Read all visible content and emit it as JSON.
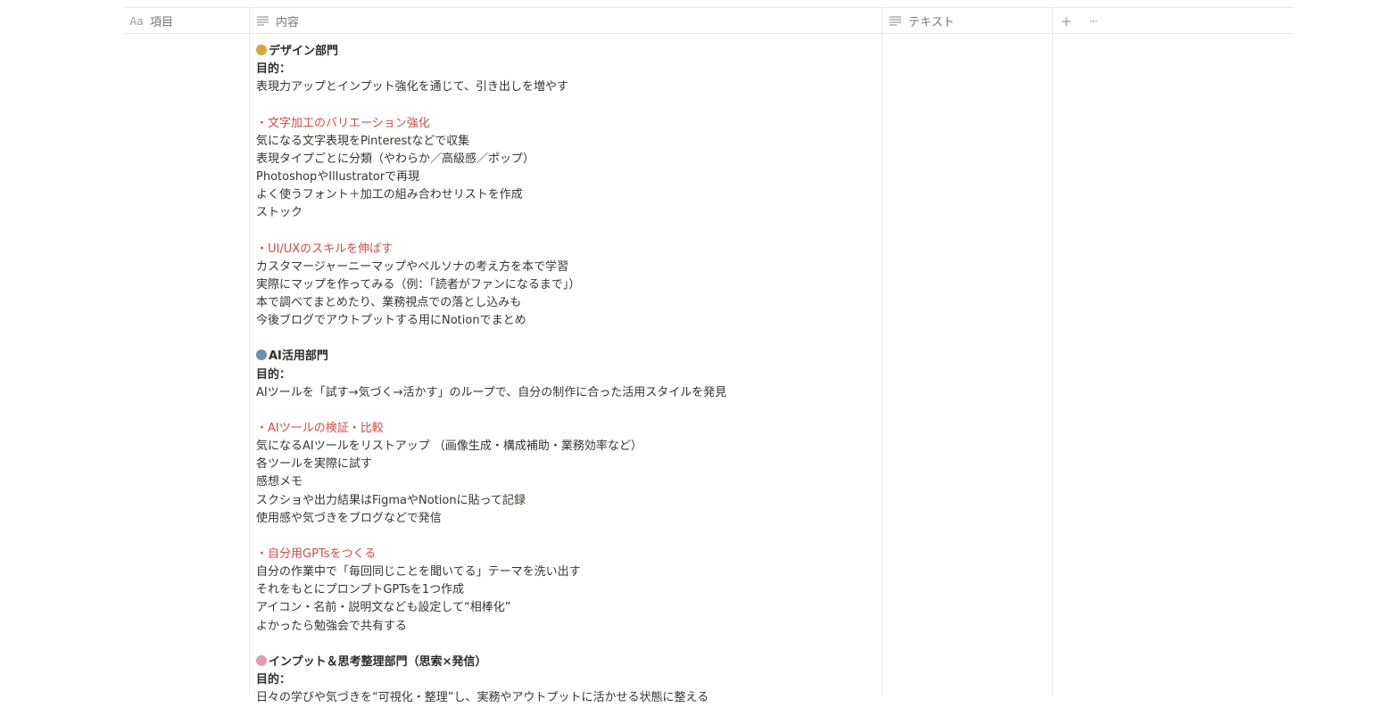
{
  "header": {
    "item": {
      "icon": "Aa",
      "label": "項目"
    },
    "content": {
      "icon": "text-lines-icon",
      "label": "内容"
    },
    "text": {
      "icon": "text-lines-icon",
      "label": "テキスト"
    },
    "add_icon": "+",
    "more_icon": "···"
  },
  "content_lines": [
    {
      "text": "デザイン部門",
      "style": "bold",
      "emoji": "palette-icon",
      "emoji_color": "#d9a441"
    },
    {
      "text": "目的：",
      "style": "bold"
    },
    {
      "text": "表現力アップとインプット強化を通じて、引き出しを増やす",
      "style": "normal"
    },
    {
      "text": "",
      "style": "blank"
    },
    {
      "text": "・文字加工のバリエーション強化",
      "style": "red"
    },
    {
      "text": "気になる文字表現をPinterestなどで収集",
      "style": "normal"
    },
    {
      "text": "表現タイプごとに分類（やわらか／高級感／ポップ）",
      "style": "normal"
    },
    {
      "text": "PhotoshopやIllustratorで再現",
      "style": "normal"
    },
    {
      "text": "よく使うフォント＋加工の組み合わせリストを作成",
      "style": "normal"
    },
    {
      "text": "ストック",
      "style": "normal"
    },
    {
      "text": "",
      "style": "blank"
    },
    {
      "text": "・UI/UXのスキルを伸ばす",
      "style": "red"
    },
    {
      "text": "カスタマージャーニーマップやペルソナの考え方を本で学習",
      "style": "normal"
    },
    {
      "text": "実際にマップを作ってみる（例：「読者がファンになるまで」）",
      "style": "normal"
    },
    {
      "text": "本で調べてまとめたり、業務視点での落とし込みも",
      "style": "normal"
    },
    {
      "text": "今後ブログでアウトプットする用にNotionでまとめ",
      "style": "normal"
    },
    {
      "text": "",
      "style": "blank"
    },
    {
      "text": "AI活用部門",
      "style": "bold",
      "emoji": "robot-icon",
      "emoji_color": "#6e8fae"
    },
    {
      "text": "目的：",
      "style": "bold"
    },
    {
      "text": "AIツールを「試す→気づく→活かす」のループで、自分の制作に合った活用スタイルを発見",
      "style": "normal"
    },
    {
      "text": "",
      "style": "blank"
    },
    {
      "text": "・AIツールの検証・比較",
      "style": "red"
    },
    {
      "text": "気になるAIツールをリストアップ （画像生成・構成補助・業務効率など）",
      "style": "normal"
    },
    {
      "text": "各ツールを実際に試す",
      "style": "normal"
    },
    {
      "text": "感想メモ",
      "style": "normal"
    },
    {
      "text": "スクショや出力結果はFigmaやNotionに貼って記録",
      "style": "normal"
    },
    {
      "text": "使用感や気づきをブログなどで発信",
      "style": "normal"
    },
    {
      "text": "",
      "style": "blank"
    },
    {
      "text": "・自分用GPTsをつくる",
      "style": "red"
    },
    {
      "text": "自分の作業中で「毎回同じことを聞いてる」テーマを洗い出す",
      "style": "normal"
    },
    {
      "text": "それをもとにプロンプトGPTsを1つ作成",
      "style": "normal"
    },
    {
      "text": "アイコン・名前・説明文なども設定して“相棒化”",
      "style": "normal"
    },
    {
      "text": "よかったら勉強会で共有する",
      "style": "normal"
    },
    {
      "text": "",
      "style": "blank"
    },
    {
      "text": "インプット＆思考整理部門（思索×発信）",
      "style": "bold",
      "emoji": "brain-icon",
      "emoji_color": "#e79aa8"
    },
    {
      "text": "目的：",
      "style": "bold"
    },
    {
      "text": "日々の学びや気づきを“可視化・整理”し、実務やアウトプットに活かせる状態に整える",
      "style": "normal"
    }
  ]
}
